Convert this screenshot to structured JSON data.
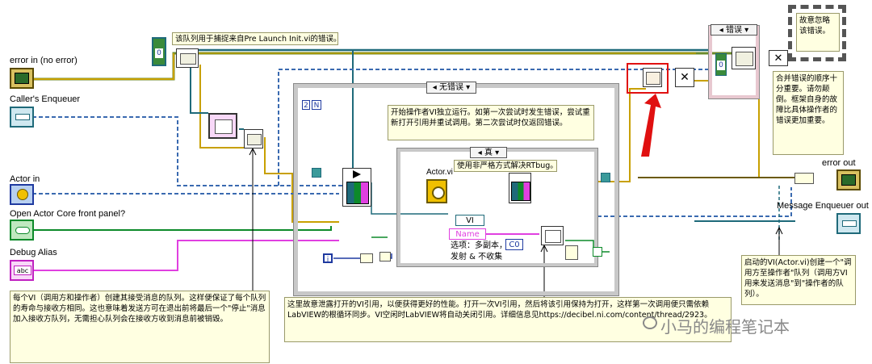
{
  "terminals": {
    "error_in": "error in (no error)",
    "callers_enqueuer": "Caller's Enqueuer",
    "actor_in": "Actor in",
    "open_fp": "Open Actor Core front panel?",
    "debug_alias": "Debug Alias",
    "error_out": "error out",
    "message_enqueuer_out": "Message Enqueuer out"
  },
  "notes": {
    "queue_note": "该队列用于捕捉来自Pre Launch Init.vi的错误。",
    "ignore_error": "故意忽略该错误。",
    "merge_order": "合并错误的顺序十分重要。请勿颠倒。框架自身的故障比具体操作者的错误更加重要。",
    "launch_note": "开始操作者VI独立运行。如第一次尝试时发生错误，尝试重新打开引用并重试调用。第二次尝试时仅返回错误。",
    "rtbug": "使用非严格方式解决RTbug。",
    "options": "选项：多副本，\n发射 & 不收集",
    "actor_vi_note": "启动的VI(Actor.vi)创建一个\"调用方至操作者\"队列（调用方VI用来发送消息\"到\"操作者的队列）。",
    "caller_actor_note": "每个VI（调用方和操作者）创建其接受消息的队列。这样便保证了每个队列的寿命与接收方相同。这也意味着发送方可在退出前将最后一个\"停止\"消息加入接收方队列，无需担心队列会在接收方收到消息前被销毁。",
    "leak_note": "这里故意泄露打开的VI引用，以便获得更好的性能。打开一次VI引用，然后将该引用保持为打开，这样第一次调用便只需依赖LabVIEW的根循环同步。VI空闲时LabVIEW将自动关闭引用。详细信息见https://decibel.ni.com/content/thread/2923。"
  },
  "case_labels": {
    "no_error": "无错误",
    "true_case": "真",
    "error_case": "错误"
  },
  "constants": {
    "zero_top": "0",
    "zero_right": "0",
    "two": "2",
    "n_constant": "N",
    "name": "Name",
    "vi": "VI",
    "c0": "C0",
    "actor_vi": "Actor.vi",
    "i_const": "i"
  },
  "watermark": "小马的编程笔记本",
  "colors": {
    "error_wire": "#c8a000",
    "error_wire_dark": "#6b5a00",
    "refnum_wire": "#1f6a7a",
    "enqueuer_wire": "#3a7ab0",
    "bool_wire": "#0d8a2a",
    "string_wire": "#e040e0",
    "highlight": "#e01010",
    "note_bg": "#ffffe1"
  }
}
